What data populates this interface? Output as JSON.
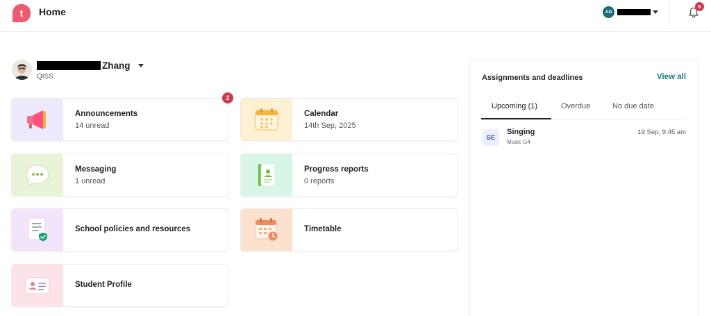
{
  "header": {
    "title": "Home",
    "logo_letter": "t",
    "account_initials": "AD",
    "notification_count": "6"
  },
  "profile": {
    "surname": "Zhang",
    "school": "QISS"
  },
  "cards": [
    {
      "id": "announcements",
      "title": "Announcements",
      "subtitle": "14 unread",
      "badge": "2",
      "icon": "megaphone-icon"
    },
    {
      "id": "calendar",
      "title": "Calendar",
      "subtitle": "14th Sep, 2025",
      "icon": "calendar-icon"
    },
    {
      "id": "messaging",
      "title": "Messaging",
      "subtitle": "1 unread",
      "icon": "chat-bubble-icon"
    },
    {
      "id": "progress-reports",
      "title": "Progress reports",
      "subtitle": "0 reports",
      "icon": "report-book-icon"
    },
    {
      "id": "school-policies",
      "title": "School policies and resources",
      "icon": "policy-document-icon"
    },
    {
      "id": "timetable",
      "title": "Timetable",
      "icon": "timetable-clock-icon"
    },
    {
      "id": "student-profile",
      "title": "Student Profile",
      "icon": "id-card-icon"
    }
  ],
  "assignments": {
    "title": "Assignments and deadlines",
    "view_all": "View all",
    "tabs": [
      "Upcoming (1)",
      "Overdue",
      "No due date"
    ],
    "items": [
      {
        "badge": "SE",
        "title": "Singing",
        "subtitle": "Music G4",
        "date": "19 Sep, 9:45 am"
      }
    ]
  },
  "colors": {
    "brand": "#ef5a6f",
    "accent": "#1f7a80",
    "badge": "#d2384d"
  }
}
